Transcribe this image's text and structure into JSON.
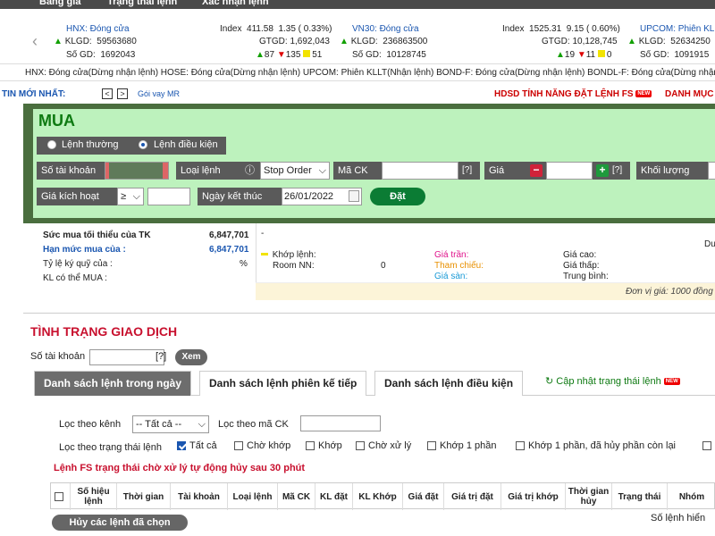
{
  "topnav": {
    "items": [
      "Bảng giá",
      "Trạng thái lệnh",
      "Xác nhận lệnh"
    ]
  },
  "ticker": {
    "hnx": {
      "name": "HNX: Đóng cửa",
      "klgd_label": "KLGD:",
      "klgd": "59563680",
      "sogd_label": "Số GD:",
      "sogd": "1692043",
      "index_label": "Index",
      "index": "411.58",
      "change": "1.35 ( 0.33%)",
      "gtgd_label": "GTGD:",
      "gtgd": "1,692,043",
      "up": "87",
      "down": "135",
      "ref": "51"
    },
    "vn30": {
      "name": "VN30: Đóng cửa",
      "klgd_label": "KLGD:",
      "klgd": "236863500",
      "sogd_label": "Số GD:",
      "sogd": "10128745",
      "index_label": "Index",
      "index": "1525.31",
      "change": "9.15 ( 0.60%)",
      "gtgd_label": "GTGD:",
      "gtgd": "10,128,745",
      "up": "19",
      "down": "11",
      "ref": "0"
    },
    "upcom": {
      "name": "UPCOM: Phiên KL",
      "klgd_label": "KLGD:",
      "klgd": "52634250",
      "sogd_label": "Số GD:",
      "sogd": "1091915"
    }
  },
  "status_line": "HNX: Đóng cửa(Dừng nhận lệnh)  HOSE: Đóng cửa(Dừng nhận lệnh)  UPCOM: Phiên KLLT(Nhận lệnh)  BOND-F: Đóng cửa(Dừng nhận lệnh)  BONDL-F: Đóng cửa(Dừng nhận",
  "news": {
    "label": "TIN MỚI NHẤT:",
    "prev": "<",
    "next": ">",
    "headline": "Gói vay MR",
    "hdsd": "HDSD TÍNH NĂNG ĐẶT LỆNH FS",
    "new_badge": "NEW",
    "danh_muc": "DANH MỤC"
  },
  "order": {
    "title": "MUA",
    "radio_normal": "Lệnh thường",
    "radio_conditional": "Lệnh điều kiện",
    "account_label": "Số tài khoản",
    "order_type_label": "Loại lệnh",
    "order_type_value": "Stop Order",
    "symbol_label": "Mã CK",
    "help": "[?]",
    "price_label": "Giá",
    "minus": "−",
    "plus": "+",
    "volume_label": "Khối lượng",
    "trigger_label": "Giá kích hoạt",
    "trigger_op": "≥",
    "end_date_label": "Ngày kết thúc",
    "end_date_value": "26/01/2022",
    "submit": "Đặt"
  },
  "info": {
    "min_buy_label": "Sức mua tối thiểu của TK",
    "min_buy": "6,847,701",
    "limit_label": "Hạn mức mua của :",
    "limit": "6,847,701",
    "margin_label": "Tỷ lệ ký quỹ của :",
    "margin_unit": "%",
    "kl_label": "KL có thể MUA :",
    "dash": "-",
    "khop_label": "Khớp lệnh:",
    "room_label": "Room NN:",
    "room": "0",
    "tran": "Giá trần:",
    "tham_chieu": "Tham chiếu:",
    "san": "Giá sàn:",
    "cao": "Giá cao:",
    "thap": "Giá thấp:",
    "tb": "Trung bình:",
    "du": "Du",
    "unit": "Đơn vị giá: 1000 đồng -"
  },
  "status": {
    "title": "TÌNH TRẠNG GIAO DỊCH",
    "account_label": "Số tài khoản",
    "help": "[?]",
    "view": "Xem",
    "tabs": [
      "Danh sách lệnh trong ngày",
      "Danh sách lệnh phiên kế tiếp",
      "Danh sách lệnh điều kiện"
    ],
    "refresh": "Cập nhật trạng thái lệnh",
    "filter_channel_label": "Lọc theo kênh",
    "filter_channel_value": "-- Tất cả --",
    "filter_symbol_label": "Lọc theo mã CK",
    "filter_state_label": "Lọc theo trạng thái lệnh",
    "states": [
      "Tất cả",
      "Chờ khớp",
      "Khớp",
      "Chờ xử lý",
      "Khớp 1 phần",
      "Khớp 1 phần, đã hủy phần còn lại"
    ],
    "notice": "Lệnh FS trạng thái chờ xử lý tự động hủy sau 30 phút",
    "columns": [
      "Số hiệu lệnh",
      "Thời gian",
      "Tài khoản",
      "Loại lệnh",
      "Mã CK",
      "KL đặt",
      "KL Khớp",
      "Giá đặt",
      "Giá trị đặt",
      "Giá trị khớp",
      "Thời gian hủy",
      "Trạng thái",
      "Nhóm"
    ],
    "cancel_selected": "Hủy các lệnh đã chọn",
    "order_count": "Số lệnh hiển"
  },
  "colors": {
    "green_panel": "#bdf2bd",
    "dark_frame": "#4a6e3e",
    "title_red": "#c8102e",
    "accent_green": "#0b7c34"
  }
}
